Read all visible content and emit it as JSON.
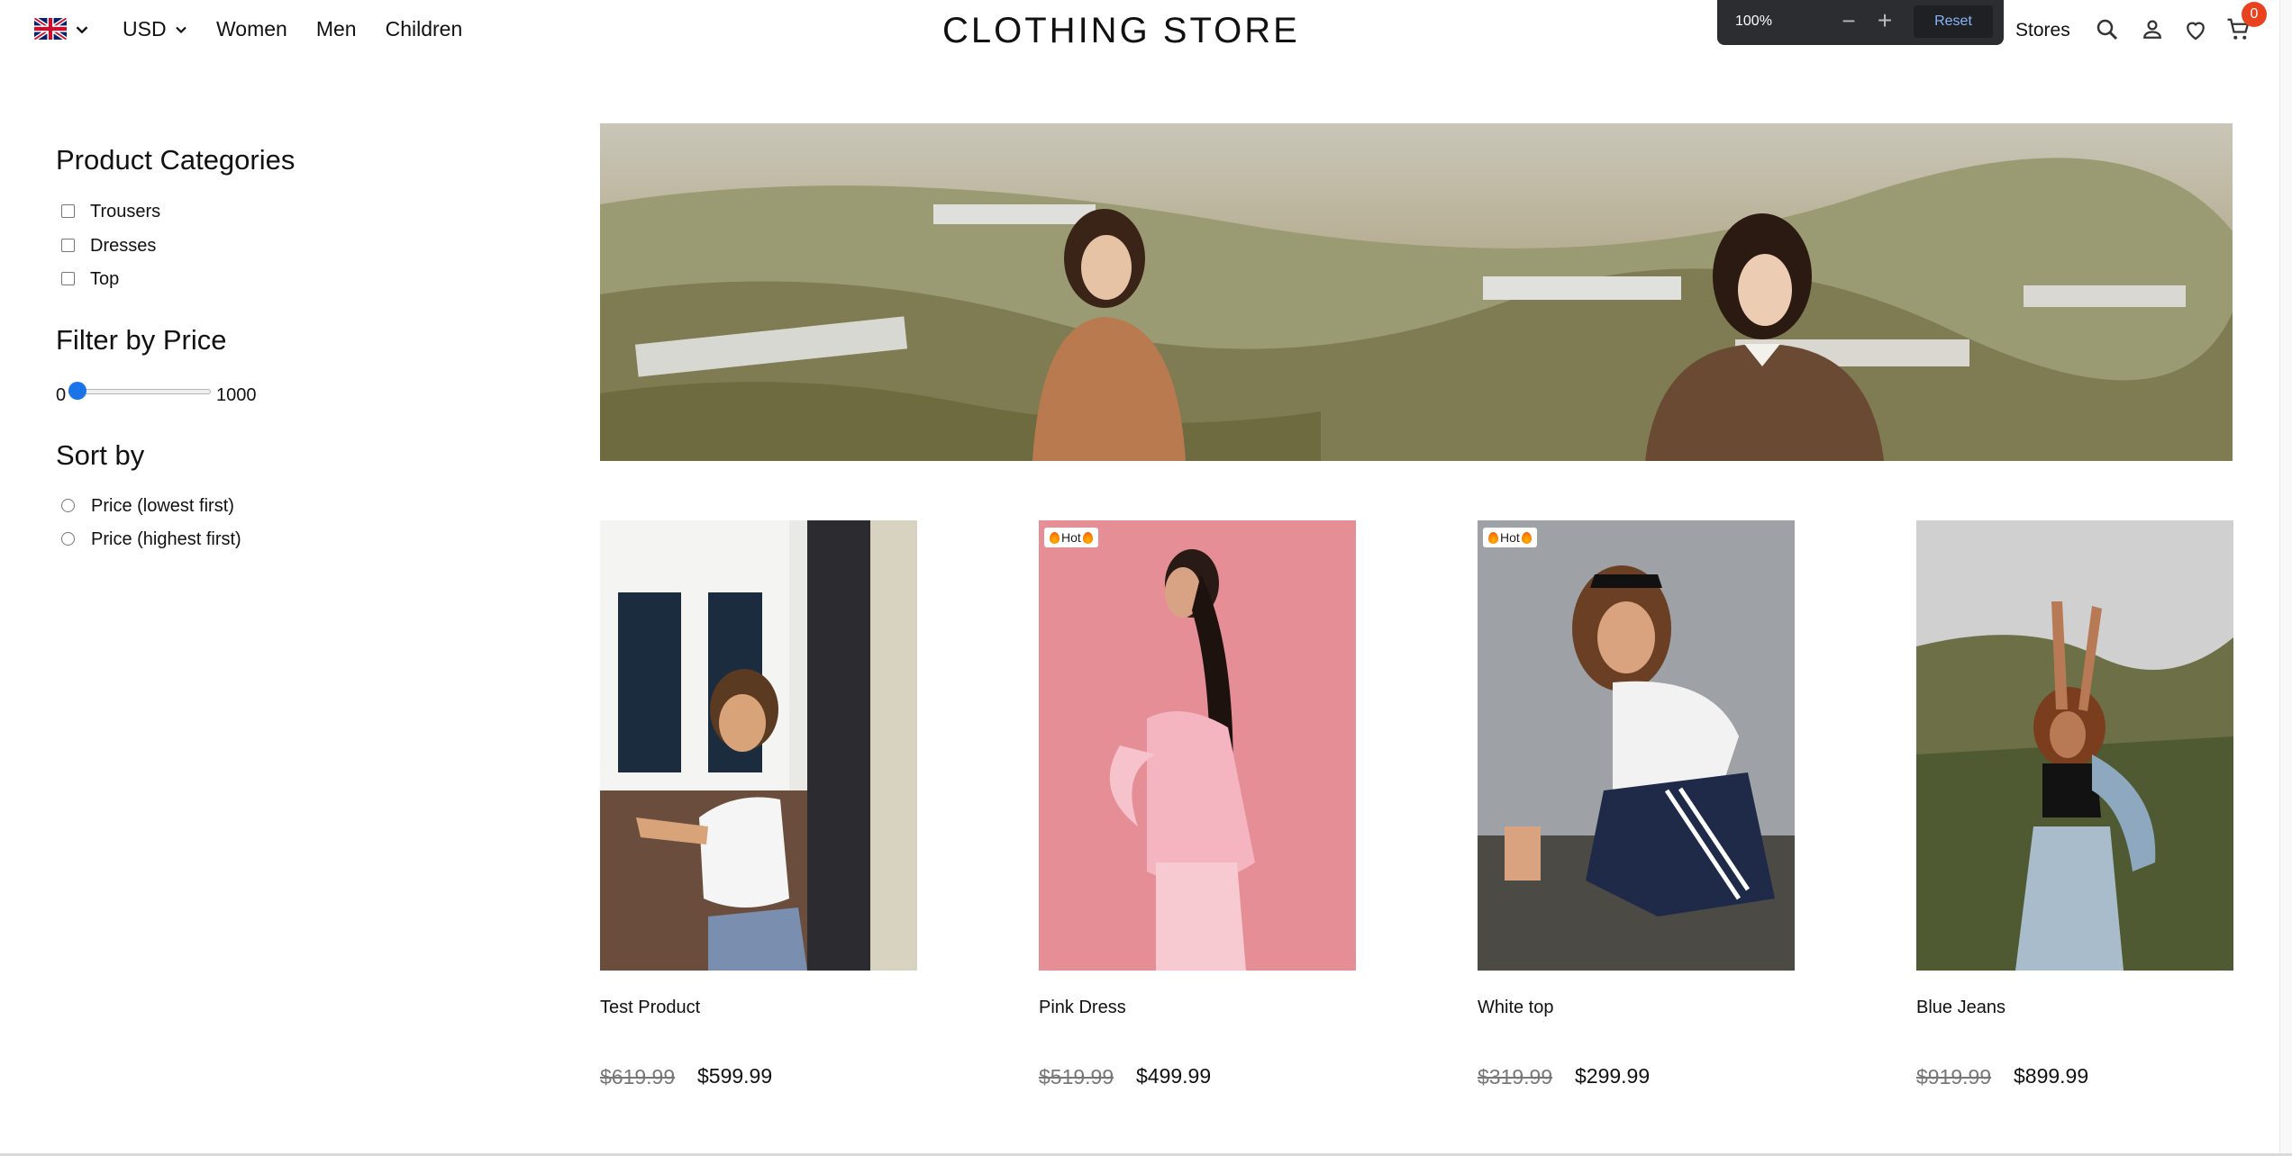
{
  "header": {
    "currency": "USD",
    "nav": [
      "Women",
      "Men",
      "Children"
    ],
    "brand": "CLOTHING STORE",
    "stores": "Stores",
    "cart_count": "0"
  },
  "zoom": {
    "level": "100%",
    "reset": "Reset"
  },
  "sidebar": {
    "categories_title": "Product Categories",
    "categories": [
      "Trousers",
      "Dresses",
      "Top"
    ],
    "price_title": "Filter by Price",
    "price_min": "0",
    "price_max": "1000",
    "price_slider_value": 0.05,
    "sort_title": "Sort by",
    "sort_options": [
      "Price (lowest first)",
      "Price (highest first)"
    ]
  },
  "products": [
    {
      "name": "Test Product",
      "old_price": "$619.99",
      "price": "$599.99",
      "badge": ""
    },
    {
      "name": "Pink Dress",
      "old_price": "$519.99",
      "price": "$499.99",
      "badge": "Hot"
    },
    {
      "name": "White top",
      "old_price": "$319.99",
      "price": "$299.99",
      "badge": "Hot"
    },
    {
      "name": "Blue Jeans",
      "old_price": "$919.99",
      "price": "$899.99",
      "badge": ""
    }
  ],
  "colors": {
    "accent": "#1a73e8",
    "cart_badge": "#e8431e"
  }
}
